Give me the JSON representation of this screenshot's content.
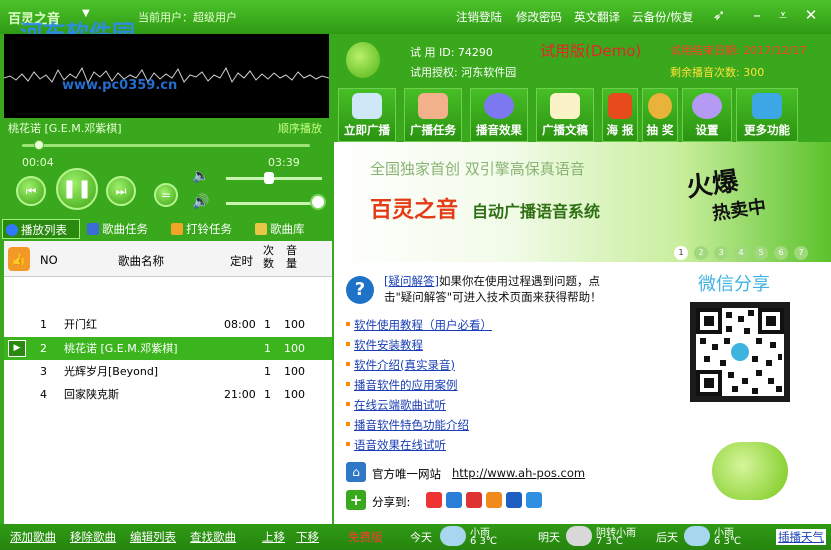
{
  "titlebar": {
    "app_name": "百灵之音",
    "current_user_label": "当前用户：超级用户",
    "menu": [
      "注销登陆",
      "修改密码",
      "英文翻译",
      "云备份/恢复"
    ],
    "watermark": "河东软件园",
    "watermark_url": "www.pc0359.cn"
  },
  "player": {
    "song": "桃花诺 [G.E.M.邓紫棋]",
    "play_mode": "顺序播放",
    "time_current": "00:04",
    "time_total": "03:39",
    "progress_fraction": 0.04
  },
  "tabs": [
    "播放列表",
    "歌曲任务",
    "打铃任务",
    "歌曲库"
  ],
  "playlist": {
    "headers": {
      "no": "NO",
      "name": "歌曲名称",
      "time": "定时",
      "count": "次数",
      "volume": "音量"
    },
    "rows": [
      {
        "no": "1",
        "name": "开门红",
        "time": "08:00",
        "count": "1",
        "volume": "100"
      },
      {
        "no": "2",
        "name": "桃花诺 [G.E.M.邓紫棋]",
        "time": "",
        "count": "1",
        "volume": "100"
      },
      {
        "no": "3",
        "name": "光辉岁月[Beyond]",
        "time": "",
        "count": "1",
        "volume": "100"
      },
      {
        "no": "4",
        "name": "回家陕克斯",
        "time": "21:00",
        "count": "1",
        "volume": "100"
      }
    ]
  },
  "bottom": {
    "links": [
      "添加歌曲",
      "移除歌曲",
      "编辑列表",
      "查找歌曲",
      "上移",
      "下移"
    ],
    "status": "免费版",
    "weather": [
      {
        "day": "今天",
        "desc": "小雨",
        "temp": "6  3℃"
      },
      {
        "day": "明天",
        "desc": "阴转小雨",
        "temp": "7  3℃"
      },
      {
        "day": "后天",
        "desc": "小雨",
        "temp": "6  3℃"
      }
    ],
    "weather_link": "插播天气"
  },
  "license": {
    "id_label": "试 用 ID: 74290",
    "auth_label": "试用授权: 河东软件园",
    "edition": "试用版(Demo)",
    "end_date": "试用结束日期: 2017/12/17",
    "remaining": "剩余播音次数: 300"
  },
  "toolbar": [
    "立即广播",
    "广播任务",
    "播音效果",
    "广播文稿",
    "海 报",
    "抽 奖",
    "设置",
    "更多功能"
  ],
  "banner": {
    "headline": "全国独家首创    双引擎高保真语音",
    "brand": "百灵之音",
    "subtitle": "自动广播语音系统",
    "hot": "火爆",
    "hot2": "热卖中",
    "pages": [
      "1",
      "2",
      "3",
      "4",
      "5",
      "6",
      "7"
    ]
  },
  "help": {
    "link": "[疑问解答]",
    "text1": "如果你在使用过程遇到问题，点",
    "text2": "击\"疑问解答\"可进入技术页面来获得帮助！"
  },
  "links": [
    "软件使用教程（用户必看）",
    "软件安装教程",
    "软件介绍(真实录音)",
    "播音软件的应用案例",
    "在线云端歌曲试听",
    "播音软件特色功能介绍",
    "语音效果在线试听"
  ],
  "website_label": "官方唯一网站",
  "website_url": "http://www.ah-pos.com",
  "share_label": "分享到:",
  "wechat_share": "微信分享"
}
